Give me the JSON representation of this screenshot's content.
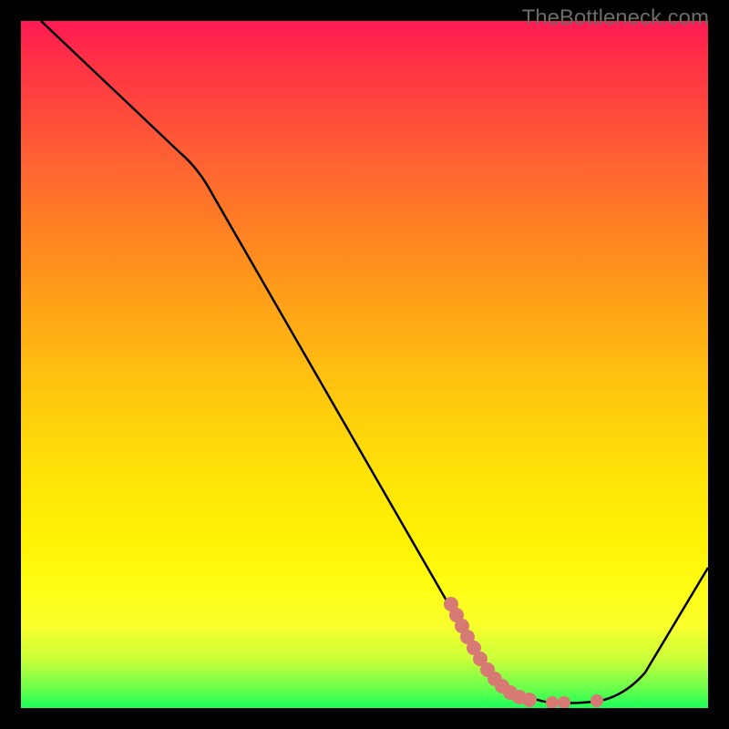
{
  "watermark": "TheBottleneck.com",
  "chart_data": {
    "type": "line",
    "title": "",
    "xlabel": "",
    "ylabel": "",
    "xlim": [
      0,
      100
    ],
    "ylim": [
      0,
      100
    ],
    "gradient_colors": {
      "top": "#ff1a53",
      "middle": "#fff305",
      "bottom": "#1bff59"
    },
    "series": [
      {
        "name": "main-curve",
        "color": "#000000",
        "x": [
          3,
          25,
          63,
          72,
          76,
          82,
          87,
          100
        ],
        "y": [
          100,
          80,
          14,
          4,
          1,
          0,
          1,
          21
        ]
      },
      {
        "name": "highlight-band",
        "color": "#d87a74",
        "x": [
          62,
          64,
          66,
          68,
          70,
          72,
          74,
          76,
          78,
          82,
          84
        ],
        "y": [
          16,
          12,
          9,
          6,
          4,
          3,
          2,
          1,
          1,
          1,
          1
        ]
      }
    ],
    "annotations": []
  }
}
